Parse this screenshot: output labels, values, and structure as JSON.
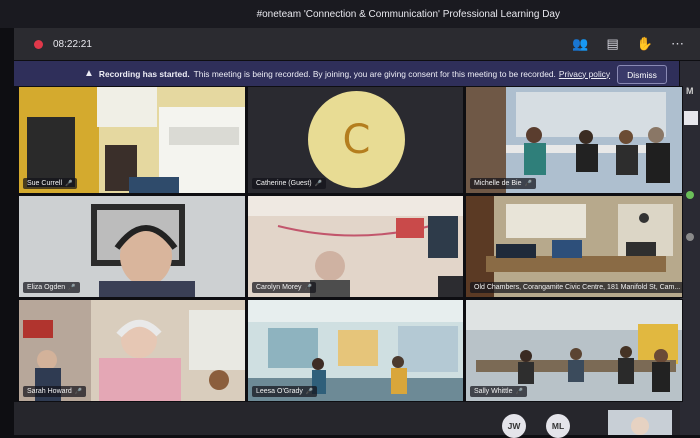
{
  "window": {
    "title": "#oneteam 'Connection & Communication' Professional Learning Day"
  },
  "toolbar": {
    "timer": "08:22:21",
    "icons": [
      "people-icon",
      "chat-icon",
      "raise-hand-icon",
      "more-icon"
    ]
  },
  "banner": {
    "title": "Recording has started.",
    "message": "This meeting is being recorded. By joining, you are giving consent for this meeting to be recorded.",
    "link": "Privacy policy",
    "dismiss_label": "Dismiss"
  },
  "participants": [
    {
      "name": "Sue Currell"
    },
    {
      "name": "Catherine (Guest)",
      "initial": "C"
    },
    {
      "name": "Michelle de Bie"
    },
    {
      "name": "Eliza Ogden"
    },
    {
      "name": "Carolyn Morey"
    },
    {
      "name": "Old Chambers, Corangamite Civic Centre, 181 Manifold St, Cam..."
    },
    {
      "name": "Sarah Howard"
    },
    {
      "name": "Leesa O'Grady"
    },
    {
      "name": "Sally Whittle"
    }
  ],
  "overflow_avatars": [
    "JW",
    "ML"
  ],
  "colors": {
    "recording": "#e0384a",
    "banner": "#2f2f5a",
    "avatar_bg": "#e8dc94",
    "avatar_text": "#b47e1e"
  }
}
